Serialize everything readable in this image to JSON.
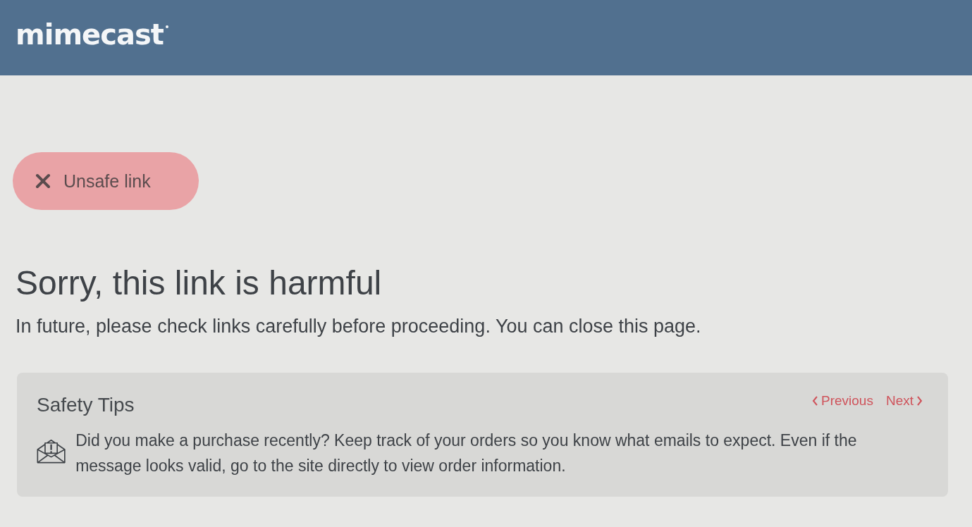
{
  "header": {
    "logo": "mimecast"
  },
  "status_badge": {
    "label": "Unsafe link",
    "kind": "unsafe"
  },
  "heading": "Sorry, this link is harmful",
  "message": "In future, please check links carefully before proceeding. You can close this page.",
  "tips": {
    "title": "Safety Tips",
    "previous": "Previous",
    "next": "Next",
    "tip": "Did you make a purchase recently? Keep track of your orders so you know what emails to expect. Even if the message looks valid, go to the site directly to view order information."
  }
}
